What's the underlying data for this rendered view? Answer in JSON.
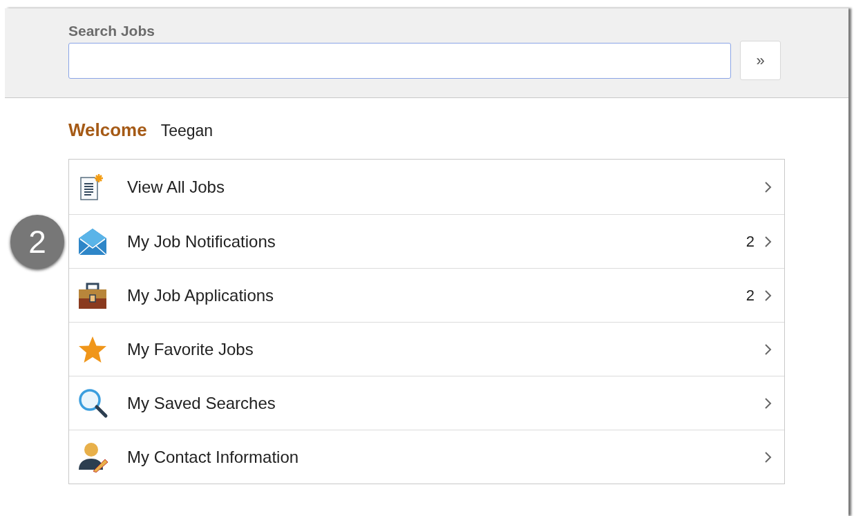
{
  "search": {
    "label": "Search Jobs",
    "button": "»"
  },
  "welcome": {
    "greeting": "Welcome",
    "name": "Teegan"
  },
  "callout": {
    "number": "2"
  },
  "items": [
    {
      "label": "View All Jobs"
    },
    {
      "label": "My Job Notifications",
      "count": "2"
    },
    {
      "label": "My Job Applications",
      "count": "2"
    },
    {
      "label": "My Favorite Jobs"
    },
    {
      "label": "My Saved Searches"
    },
    {
      "label": "My Contact Information"
    }
  ]
}
